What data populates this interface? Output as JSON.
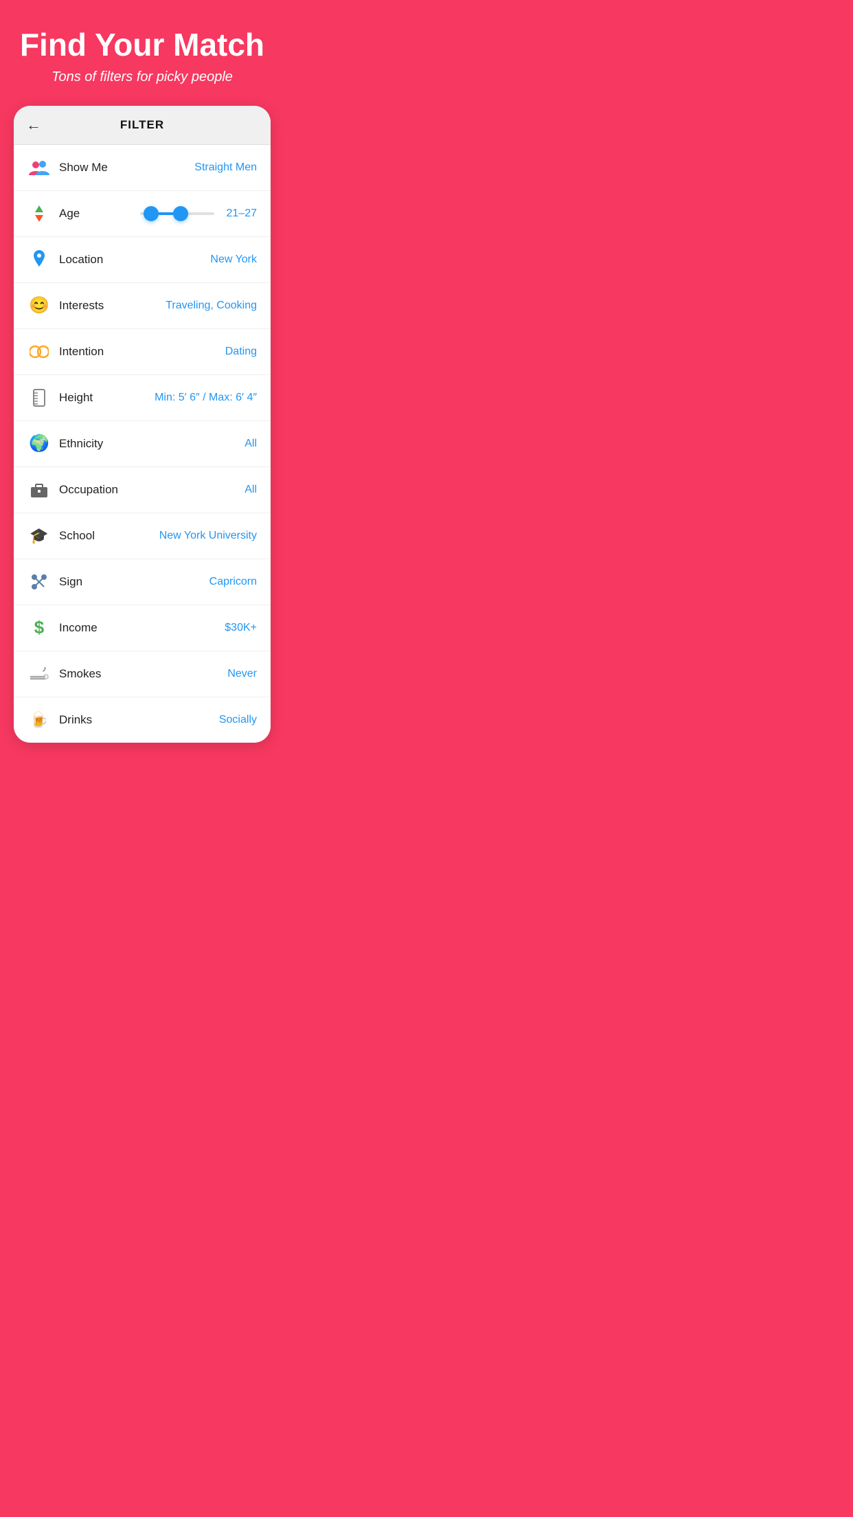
{
  "hero": {
    "title": "Find Your Match",
    "subtitle": "Tons of filters for picky people"
  },
  "header": {
    "back_label": "←",
    "title": "FILTER"
  },
  "filters": [
    {
      "id": "show-me",
      "label": "Show Me",
      "value": "Straight Men",
      "icon_type": "people"
    },
    {
      "id": "age",
      "label": "Age",
      "value": "21–27",
      "icon_type": "age"
    },
    {
      "id": "location",
      "label": "Location",
      "value": "New York",
      "icon_type": "location"
    },
    {
      "id": "interests",
      "label": "Interests",
      "value": "Traveling, Cooking",
      "icon_type": "interests"
    },
    {
      "id": "intention",
      "label": "Intention",
      "value": "Dating",
      "icon_type": "intention"
    },
    {
      "id": "height",
      "label": "Height",
      "value": "Min: 5′ 6″ / Max: 6′ 4″",
      "icon_type": "height"
    },
    {
      "id": "ethnicity",
      "label": "Ethnicity",
      "value": "All",
      "icon_type": "ethnicity"
    },
    {
      "id": "occupation",
      "label": "Occupation",
      "value": "All",
      "icon_type": "occupation"
    },
    {
      "id": "school",
      "label": "School",
      "value": "New York University",
      "icon_type": "school"
    },
    {
      "id": "sign",
      "label": "Sign",
      "value": "Capricorn",
      "icon_type": "sign"
    },
    {
      "id": "income",
      "label": "Income",
      "value": "$30K+",
      "icon_type": "income"
    },
    {
      "id": "smokes",
      "label": "Smokes",
      "value": "Never",
      "icon_type": "smokes"
    },
    {
      "id": "drinks",
      "label": "Drinks",
      "value": "Socially",
      "icon_type": "drinks"
    }
  ]
}
